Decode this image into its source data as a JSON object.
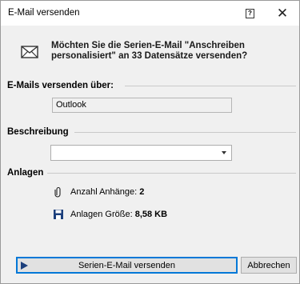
{
  "window": {
    "title": "E-Mail versenden",
    "help_icon": "help-icon",
    "close_glyph": "✕",
    "help_glyph": "?"
  },
  "question": {
    "icon": "envelope-icon",
    "line1": "Möchten Sie die Serien-E-Mail \"Anschreiben",
    "line2": "personalisiert\" an 33 Datensätze versenden?"
  },
  "send_via": {
    "label": "E-Mails versenden über:",
    "value": "Outlook"
  },
  "description": {
    "label": "Beschreibung",
    "value": ""
  },
  "attachments": {
    "label": "Anlagen",
    "count_label": "Anzahl Anhänge:",
    "count_value": "2",
    "count_icon": "paperclip-icon",
    "size_label": "Anlagen Größe:",
    "size_value": "8,58 KB",
    "size_icon": "save-disk-icon"
  },
  "buttons": {
    "send_label": "Serien-E-Mail versenden",
    "send_icon": "play-icon",
    "cancel_label": "Abbrechen"
  },
  "colors": {
    "accent": "#0078d7",
    "disk_icon": "#1c3f7c",
    "background": "#f0f0f0"
  }
}
